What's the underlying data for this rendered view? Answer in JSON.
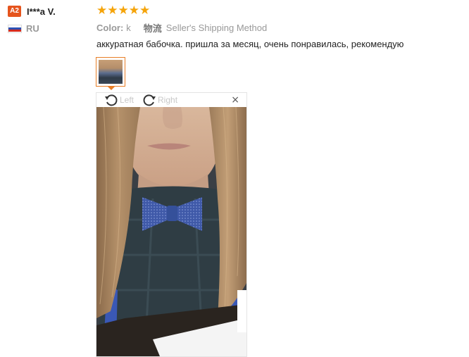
{
  "user": {
    "avatar_text": "A2",
    "name": "I***a V.",
    "country": "RU"
  },
  "review": {
    "rating": 5,
    "stars": [
      "★",
      "★",
      "★",
      "★",
      "★"
    ],
    "color_label": "Color:",
    "color_value": "k",
    "shipping_label": "物流",
    "shipping_value": "Seller's Shipping Method",
    "text": "аккуратная бабочка. пришла за месяц, очень понравилась, рекомендую"
  },
  "viewer": {
    "rotate_left_label": "Left",
    "rotate_right_label": "Right",
    "close_label": "×"
  },
  "colors": {
    "avatar_badge": "#e5541d",
    "star": "#f5a40a",
    "thumb_border": "#e87e26"
  }
}
